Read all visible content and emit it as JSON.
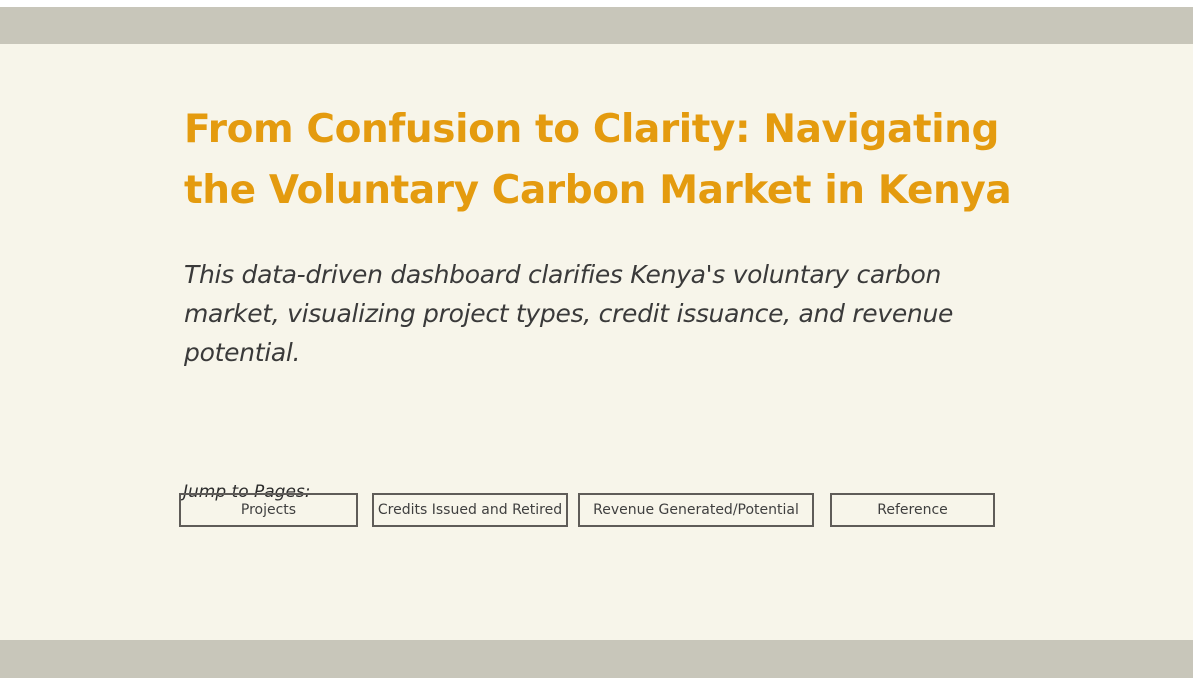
{
  "page": {
    "title": "From Confusion to Clarity: Navigating the Voluntary Carbon Market in Kenya",
    "subtitle": "This data-driven dashboard clarifies Kenya's voluntary carbon market, visualizing project types, credit issuance, and revenue potential.",
    "jump_label": "Jump to Pages:"
  },
  "nav": {
    "buttons": [
      {
        "label": "Projects"
      },
      {
        "label": "Credits Issued and Retired"
      },
      {
        "label": "Revenue Generated/Potential"
      },
      {
        "label": "Reference"
      }
    ]
  },
  "colors": {
    "title": "#e49b0f",
    "background": "#f7f5ea",
    "band": "#c8c6ba",
    "button_border": "#5f5c58"
  }
}
